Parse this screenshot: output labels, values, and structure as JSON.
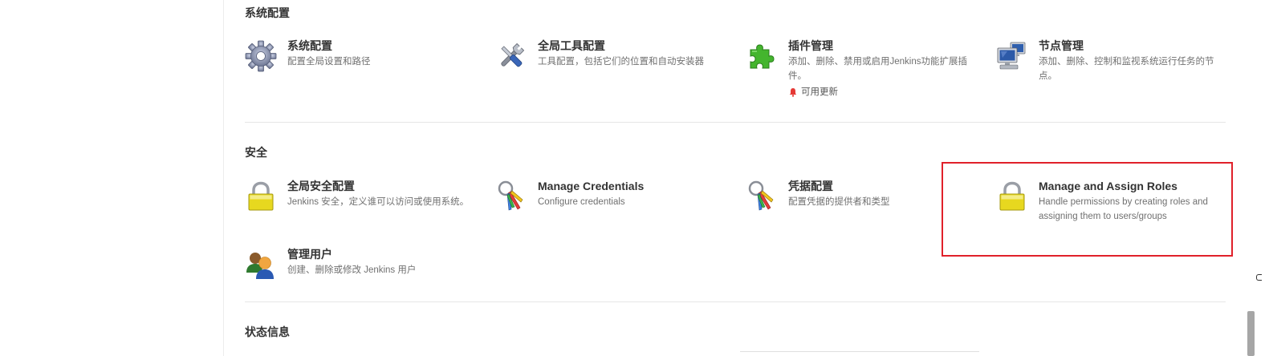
{
  "sections": {
    "system": {
      "title": "系统配置",
      "items": [
        {
          "title": "系统配置",
          "desc": "配置全局设置和路径"
        },
        {
          "title": "全局工具配置",
          "desc": "工具配置，包括它们的位置和自动安装器"
        },
        {
          "title": "插件管理",
          "desc": "添加、删除、禁用或启用Jenkins功能扩展插件。",
          "update": "可用更新"
        },
        {
          "title": "节点管理",
          "desc": "添加、删除、控制和监视系统运行任务的节点。"
        }
      ]
    },
    "security": {
      "title": "安全",
      "items": [
        {
          "title": "全局安全配置",
          "desc": "Jenkins 安全，定义谁可以访问或使用系统。"
        },
        {
          "title": "Manage Credentials",
          "desc": "Configure credentials"
        },
        {
          "title": "凭据配置",
          "desc": "配置凭据的提供者和类型"
        },
        {
          "title": "Manage and Assign Roles",
          "desc": "Handle permissions by creating roles and assigning them to users/groups"
        },
        {
          "title": "管理用户",
          "desc": "创建、删除或修改 Jenkins 用户"
        }
      ]
    },
    "status": {
      "title": "状态信息"
    }
  },
  "icons": {
    "gear": "gear-icon",
    "tools": "tools-icon",
    "plugin": "puzzle-icon",
    "nodes": "computer-icon",
    "lock": "lock-icon",
    "keys": "keys-icon",
    "users": "users-icon",
    "bell": "bell-icon"
  },
  "colors": {
    "highlight": "#e0202a",
    "update_bell": "#e53935",
    "puzzle": "#3fae2a",
    "lock": "#e2d31f"
  }
}
